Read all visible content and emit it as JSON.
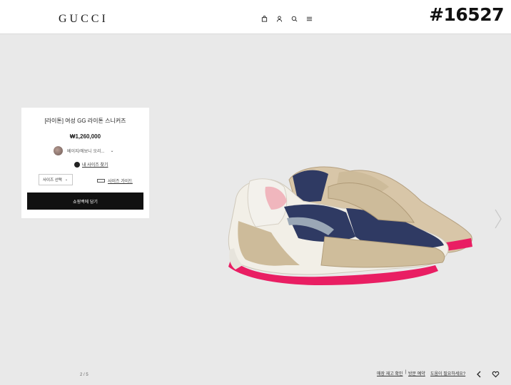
{
  "header": {
    "logo": "GUCCI",
    "icons": [
      "shopping-bag-icon",
      "user-icon",
      "search-icon",
      "menu-icon"
    ]
  },
  "overlay": {
    "code": "#16527"
  },
  "product": {
    "title": "[라이톤] 여성 GG 라이톤 스니커즈",
    "price": "₩1,260,000",
    "color_label": "베이지/에보니 오리...",
    "size_finder_label": "내 사이즈 찾기",
    "size_select_label": "사이즈 선택",
    "size_guide_label": "사이즈 가이드",
    "add_to_cart_label": "쇼핑백에 담기"
  },
  "gallery": {
    "pager": "2 / 5"
  },
  "footer": {
    "store_stock_label": "매장 재고 확인",
    "separator": "|",
    "visit_booking_label": "방문 예약",
    "help_label": "도움이 필요하세요?"
  },
  "colors": {
    "background": "#e9e9e9",
    "panel": "#ffffff",
    "button": "#111111",
    "sole_accent": "#e91e63"
  }
}
